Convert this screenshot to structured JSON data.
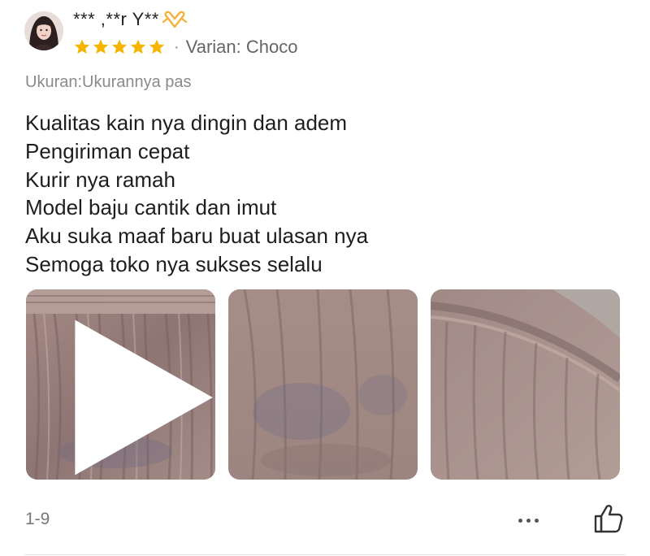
{
  "review": {
    "username": "*** ,**r Y**",
    "rating": 5,
    "variant_label": "Varian: Choco",
    "size_note": "Ukuran:Ukurannya pas",
    "body_lines": [
      "Kualitas kain nya dingin dan adem",
      "Pengiriman cepat",
      "Kurir nya ramah",
      "Model baju cantik dan imut",
      "Aku suka maaf baru buat ulasan nya",
      "Semoga toko nya sukses selalu"
    ],
    "page_count": "1-9"
  },
  "icons": {
    "avatar": "user-avatar",
    "emoji": "heart-hands-emoji",
    "star": "star-icon",
    "play": "play-icon",
    "more": "more-options-icon",
    "like": "thumbs-up-icon"
  },
  "colors": {
    "star": "#f7b500",
    "emoji": "#f2b23b",
    "text": "#1e1e1e",
    "muted": "#8a8a8a"
  }
}
